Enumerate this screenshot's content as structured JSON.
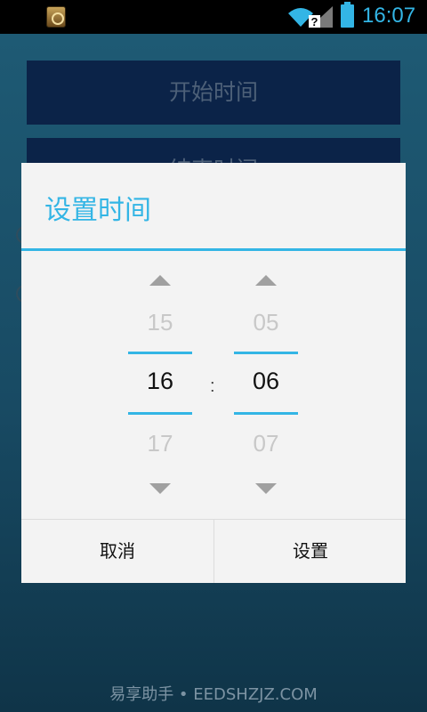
{
  "status_bar": {
    "time": "16:07",
    "icons": [
      "app-notification-icon",
      "wifi-icon",
      "signal-icon",
      "battery-icon"
    ],
    "accent": "#33b5e5"
  },
  "background": {
    "start_time_button": "开始时间",
    "end_time_button": "结束时间",
    "watermark": "易享助手 • EEDSHZJZ.COM"
  },
  "dialog": {
    "title": "设置时间",
    "hour": {
      "prev": "15",
      "current": "16",
      "next": "17"
    },
    "separator": ":",
    "minute": {
      "prev": "05",
      "current": "06",
      "next": "07"
    },
    "cancel_label": "取消",
    "set_label": "设置",
    "accent": "#33b5e5"
  }
}
